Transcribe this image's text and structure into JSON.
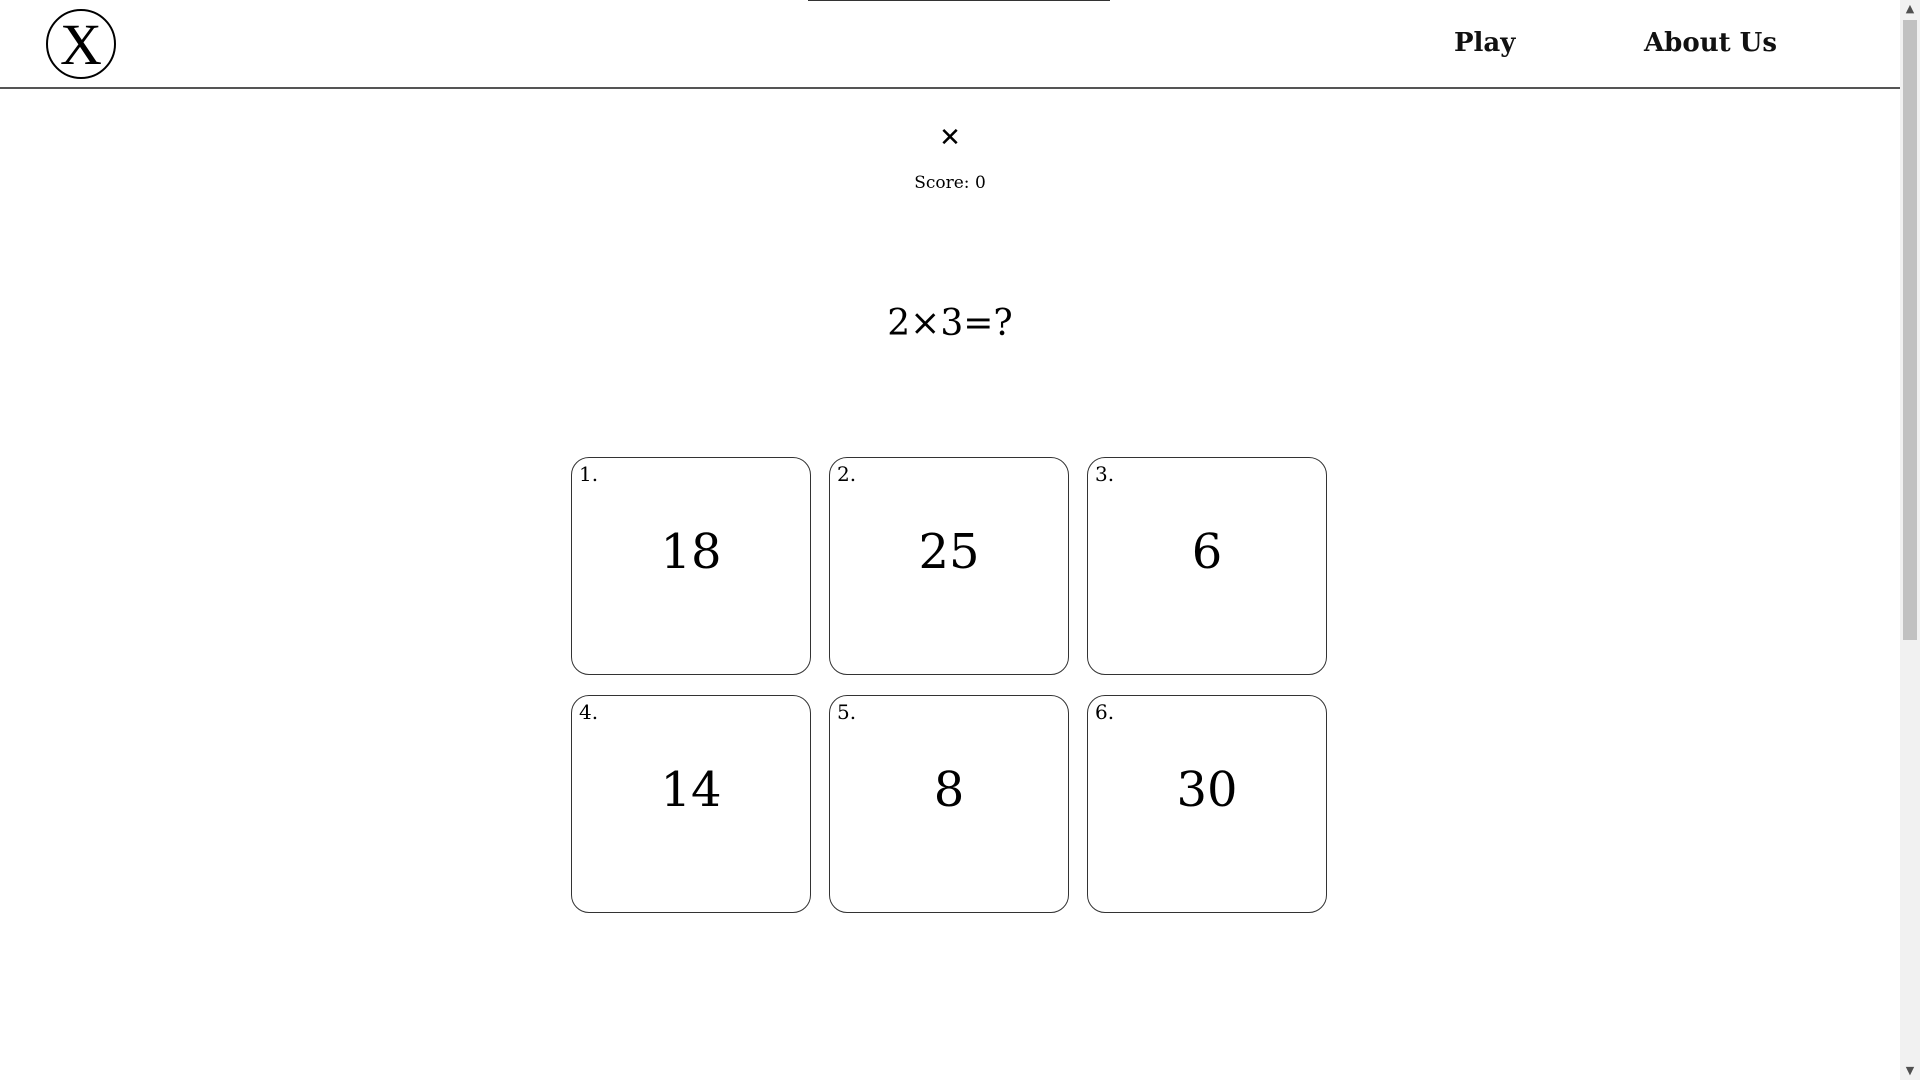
{
  "header": {
    "logo_letter": "X",
    "nav": {
      "play": "Play",
      "about": "About Us"
    }
  },
  "game": {
    "close_symbol": "✕",
    "score_label": "Score: 0",
    "question": "2×3=?",
    "options": [
      {
        "index": "1.",
        "value": "18"
      },
      {
        "index": "2.",
        "value": "25"
      },
      {
        "index": "3.",
        "value": "6"
      },
      {
        "index": "4.",
        "value": "14"
      },
      {
        "index": "5.",
        "value": "8"
      },
      {
        "index": "6.",
        "value": "30"
      }
    ]
  },
  "scrollbar": {
    "up_arrow": "▲",
    "down_arrow": "▼"
  }
}
